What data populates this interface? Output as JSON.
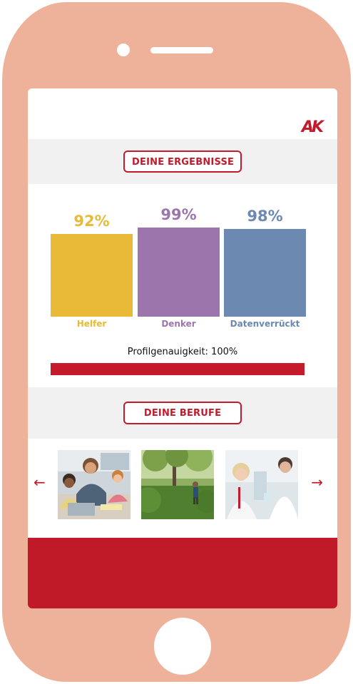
{
  "app": {
    "logo_text": "AK",
    "brand_color": "#c41a2b",
    "phone_color": "#eeb199"
  },
  "results": {
    "heading": "DEINE ERGEBNISSE"
  },
  "chart_data": {
    "type": "bar",
    "categories": [
      "Helfer",
      "Denker",
      "Datenverrückt"
    ],
    "values": [
      92,
      99,
      98
    ],
    "value_labels": [
      "92%",
      "99%",
      "98%"
    ],
    "colors": [
      "#e8ba37",
      "#9d75ad",
      "#6b89b1"
    ],
    "ylim": [
      0,
      100
    ],
    "grid": false,
    "legend": "none"
  },
  "profile": {
    "accuracy_label": "Profilgenauigkeit: 100%",
    "accuracy_value": 100
  },
  "jobs": {
    "heading": "DEINE BERUFE",
    "prev_icon": "arrow-left-icon",
    "next_icon": "arrow-right-icon",
    "prev_glyph": "←",
    "next_glyph": "→",
    "images": [
      "classroom-photo",
      "forest-photo",
      "laboratory-photo"
    ]
  }
}
